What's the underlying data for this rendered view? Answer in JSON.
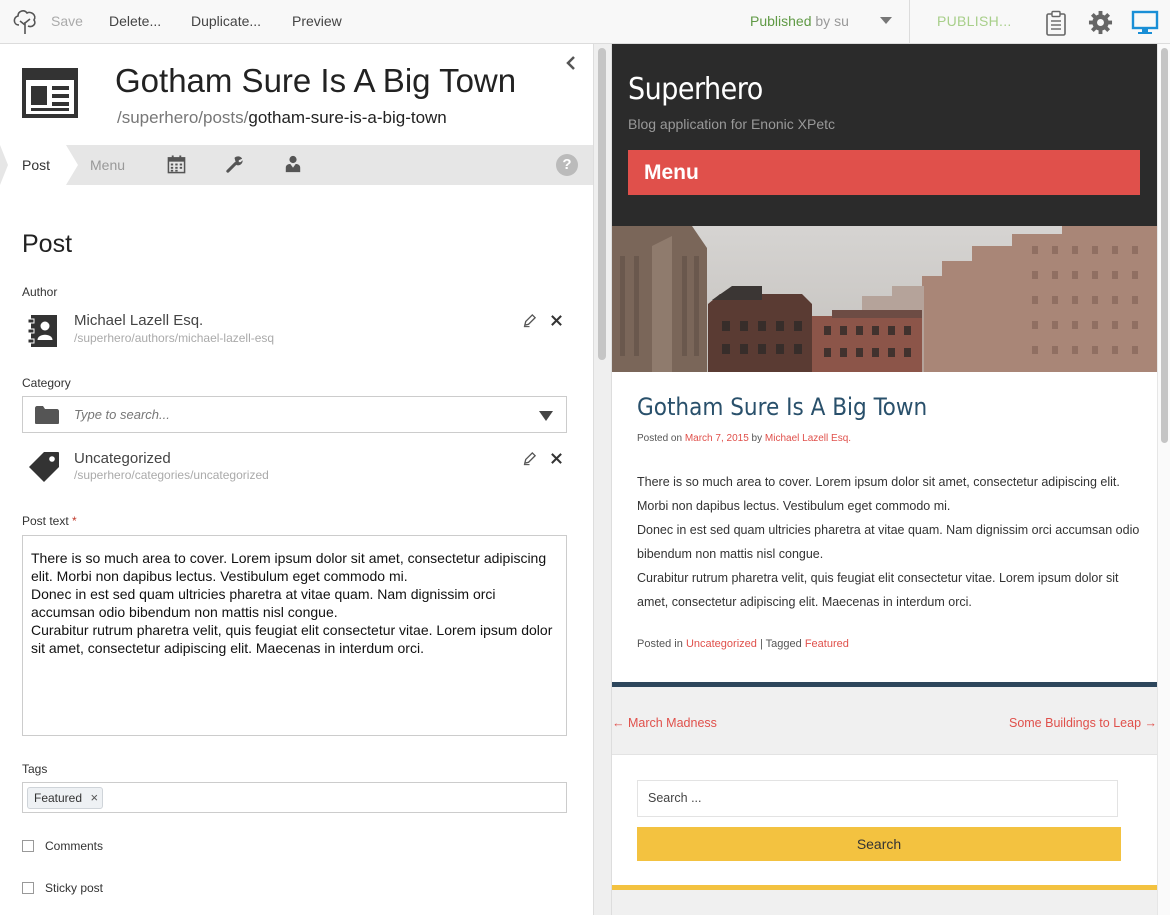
{
  "toolbar": {
    "save": "Save",
    "delete": "Delete...",
    "duplicate": "Duplicate...",
    "preview": "Preview",
    "status": "Published",
    "status_by": "by su",
    "publish": "PUBLISH..."
  },
  "editor_header": {
    "title": "Gotham Sure Is A Big Town",
    "path_prefix": "/superhero/posts/",
    "path_name": "gotham-sure-is-a-big-town"
  },
  "tabs": {
    "post": "Post",
    "menu": "Menu"
  },
  "form": {
    "section_title": "Post",
    "author_label": "Author",
    "author": {
      "name": "Michael Lazell Esq.",
      "path": "/superhero/authors/michael-lazell-esq"
    },
    "category_label": "Category",
    "category_placeholder": "Type to search...",
    "category": {
      "name": "Uncategorized",
      "path": "/superhero/categories/uncategorized"
    },
    "post_text_label": "Post text",
    "required_mark": "*",
    "post_text": [
      "There is so much area to cover. Lorem ipsum dolor sit amet, consectetur adipiscing elit. Morbi non dapibus lectus. Vestibulum eget commodo mi.",
      "Donec in est sed quam ultricies pharetra at vitae quam. Nam dignissim orci accumsan odio bibendum non mattis nisl congue.",
      "Curabitur rutrum pharetra velit, quis feugiat elit consectetur vitae. Lorem ipsum dolor sit amet, consectetur adipiscing elit. Maecenas in interdum orci."
    ],
    "tags_label": "Tags",
    "tags": [
      "Featured"
    ],
    "comments_label": "Comments",
    "sticky_label": "Sticky post"
  },
  "preview": {
    "site_title": "Superhero",
    "tagline": "Blog application for Enonic XPetc",
    "menu": "Menu",
    "post_title": "Gotham Sure Is A Big Town",
    "posted_on": "Posted on",
    "date": "March 7, 2015",
    "by": "by",
    "author": "Michael Lazell Esq.",
    "body": [
      "There is so much area to cover. Lorem ipsum dolor sit amet, consectetur adipiscing elit. Morbi non dapibus lectus. Vestibulum eget commodo mi.",
      "Donec in est sed quam ultricies pharetra at vitae quam. Nam dignissim orci accumsan odio bibendum non mattis nisl congue.",
      "Curabitur rutrum pharetra velit, quis feugiat elit consectetur vitae. Lorem ipsum dolor sit amet, consectetur adipiscing elit. Maecenas in interdum orci."
    ],
    "posted_in": "Posted in",
    "category": "Uncategorized",
    "tagged": "| Tagged",
    "tag": "Featured",
    "prev_link": "← March Madness",
    "next_link": "Some Buildings to Leap →",
    "search_placeholder": "Search ...",
    "search_button": "Search"
  },
  "colors": {
    "status_green": "#609a45",
    "publish_green": "#a8cf8a",
    "preview_accent": "#e0504b",
    "preview_header": "#2b2b2b",
    "search_yellow": "#f3c240",
    "title_blue": "#29506b",
    "monitor_blue": "#1a8fd6"
  },
  "icons": {
    "logo": "tree-logo-icon",
    "content_type": "newspaper-icon",
    "author": "address-book-icon",
    "category": "tag-icon",
    "combo": "folder-icon",
    "issues": "clipboard-icon",
    "settings": "gear-icon",
    "preview": "monitor-icon"
  }
}
